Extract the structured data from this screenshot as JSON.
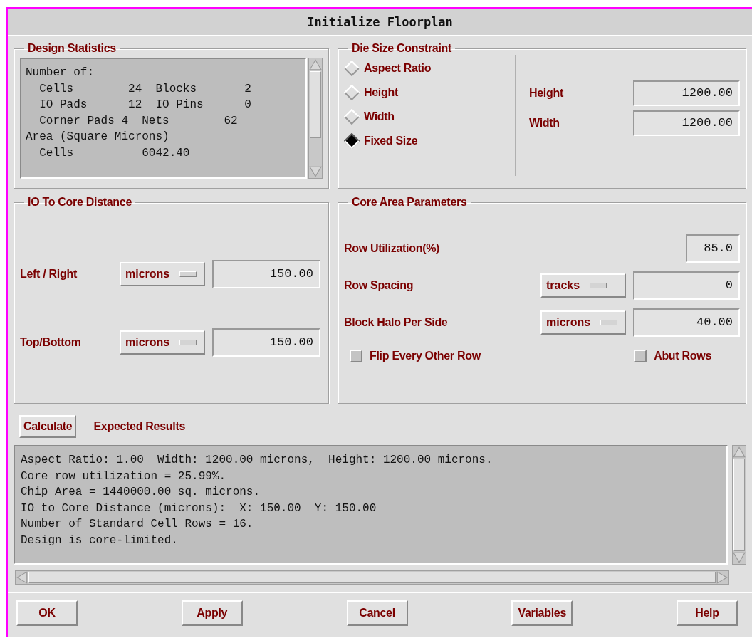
{
  "window": {
    "title": "Initialize Floorplan"
  },
  "design_statistics": {
    "title": "Design Statistics",
    "lines": [
      "Number of:",
      "  Cells        24  Blocks       2",
      "  IO Pads      12  IO Pins      0",
      "  Corner Pads 4  Nets        62",
      "Area (Square Microns)",
      "  Cells          6042.40"
    ]
  },
  "die_size_constraint": {
    "title": "Die Size Constraint",
    "options": [
      {
        "label": "Aspect Ratio",
        "selected": false
      },
      {
        "label": "Height",
        "selected": false
      },
      {
        "label": "Width",
        "selected": false
      },
      {
        "label": "Fixed Size",
        "selected": true
      }
    ],
    "fields": [
      {
        "label": "Height",
        "value": "1200.00"
      },
      {
        "label": "Width",
        "value": "1200.00"
      }
    ]
  },
  "io_to_core_distance": {
    "title": "IO To Core Distance",
    "rows": [
      {
        "label": "Left / Right",
        "unit": "microns",
        "value": "150.00"
      },
      {
        "label": "Top/Bottom",
        "unit": "microns",
        "value": "150.00"
      }
    ]
  },
  "core_area_parameters": {
    "title": "Core Area Parameters",
    "rows": [
      {
        "label": "Row Utilization(%)",
        "value": "85.0"
      },
      {
        "label": "Row Spacing",
        "unit": "tracks",
        "value": "0"
      },
      {
        "label": "Block Halo Per Side",
        "unit": "microns",
        "value": "40.00"
      }
    ],
    "checkboxes": [
      {
        "label": "Flip Every Other Row",
        "checked": false
      },
      {
        "label": "Abut Rows",
        "checked": false
      }
    ]
  },
  "calculate": {
    "button": "Calculate",
    "title": "Expected Results"
  },
  "results": {
    "lines": [
      "Aspect Ratio: 1.00  Width: 1200.00 microns,  Height: 1200.00 microns.",
      "Core row utilization = 25.99%.",
      "Chip Area = 1440000.00 sq. microns.",
      "IO to Core Distance (microns):  X: 150.00  Y: 150.00",
      "Number of Standard Cell Rows = 16.",
      "Design is core-limited."
    ]
  },
  "buttons": [
    "OK",
    "Apply",
    "Cancel",
    "Variables",
    "Help"
  ]
}
